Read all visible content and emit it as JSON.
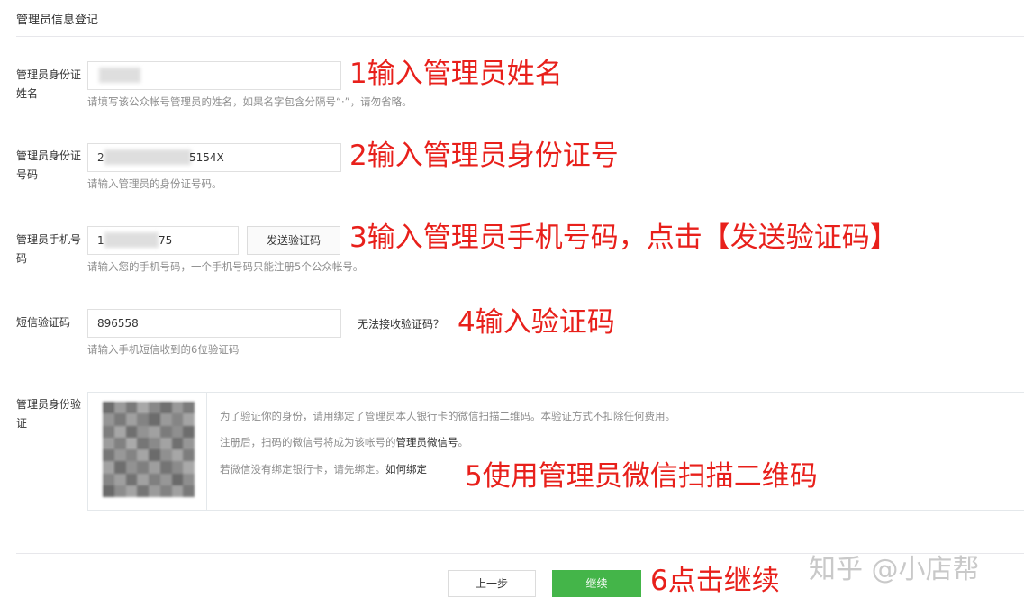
{
  "page": {
    "title": "管理员信息登记"
  },
  "name_field": {
    "label": "管理员身份证姓名",
    "value": "",
    "hint": "请填写该公众帐号管理员的姓名，如果名字包含分隔号“·”，请勿省略。"
  },
  "id_field": {
    "label": "管理员身份证号码",
    "value_start": "2",
    "value_end": "5154X",
    "hint": "请输入管理员的身份证号码。"
  },
  "phone_field": {
    "label": "管理员手机号码",
    "value_start": "1",
    "value_end": "75",
    "send_code_label": "发送验证码",
    "hint": "请输入您的手机号码，一个手机号码只能注册5个公众帐号。"
  },
  "sms_field": {
    "label": "短信验证码",
    "value": "896558",
    "cannot_receive_label": "无法接收验证码？",
    "hint": "请输入手机短信收到的6位验证码"
  },
  "verify_field": {
    "label": "管理员身份验证",
    "line1": "为了验证你的身份，请用绑定了管理员本人银行卡的微信扫描二维码。本验证方式不扣除任何费用。",
    "line2_prefix": "注册后，扫码的微信号将成为该帐号的",
    "line2_emphasis": "管理员微信号",
    "line2_suffix": "。",
    "line3_prefix": "若微信没有绑定银行卡，请先绑定。",
    "line3_link": "如何绑定"
  },
  "annotations": {
    "step1": "1输入管理员姓名",
    "step2": "2输入管理员身份证号",
    "step3": "3输入管理员手机号码，点击【发送验证码】",
    "step4": "4输入验证码",
    "step5": "5使用管理员微信扫描二维码",
    "step6": "6点击继续"
  },
  "footer": {
    "prev_label": "上一步",
    "next_label": "继续"
  },
  "watermark": "知乎 @小店帮",
  "colors": {
    "annotation_red": "#e8201b",
    "primary_green": "#44b549",
    "hint_gray": "#8d8d8d"
  }
}
